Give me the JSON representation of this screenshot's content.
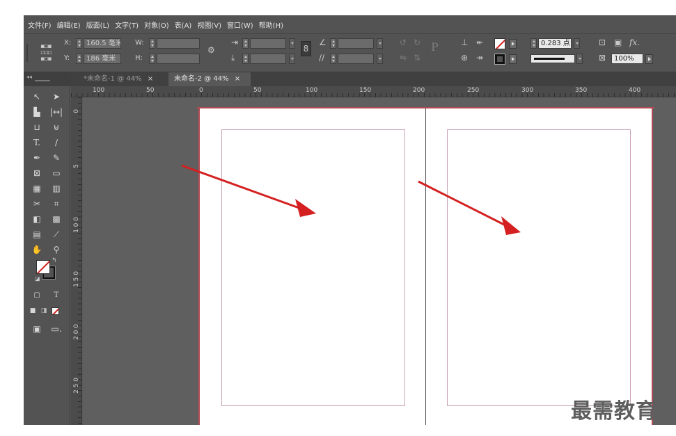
{
  "menu": {
    "items": [
      "文件(F)",
      "编辑(E)",
      "版面(L)",
      "文字(T)",
      "对象(O)",
      "表(A)",
      "视图(V)",
      "窗口(W)",
      "帮助(H)"
    ]
  },
  "control": {
    "x_label": "X:",
    "x_value": "160.5 毫米",
    "y_label": "Y:",
    "y_value": "186 毫米",
    "w_label": "W:",
    "h_label": "H:",
    "stroke_weight": "0.283 点",
    "opacity": "100%",
    "text_frame_glyph": "P",
    "fx_glyph": "fx."
  },
  "tabs": [
    {
      "label": "*未命名-1 @ 44%",
      "close": "×"
    },
    {
      "label": "未命名-2 @ 44%",
      "close": "×"
    }
  ],
  "ruler": {
    "h_labels": [
      "100",
      "50",
      "0",
      "50",
      "100",
      "150",
      "200",
      "250",
      "300",
      "350",
      "400"
    ],
    "v_labels": [
      "0",
      "5",
      "1 0 0",
      "1 5 0",
      "2 0 0",
      "2 5 0"
    ]
  },
  "watermark": "最需教育",
  "colors": {
    "menubar": "#535353",
    "tabbar": "#404040",
    "page_border": "#b44a55",
    "margin_guide": "#c8a2b6",
    "arrow": "#d42020"
  }
}
